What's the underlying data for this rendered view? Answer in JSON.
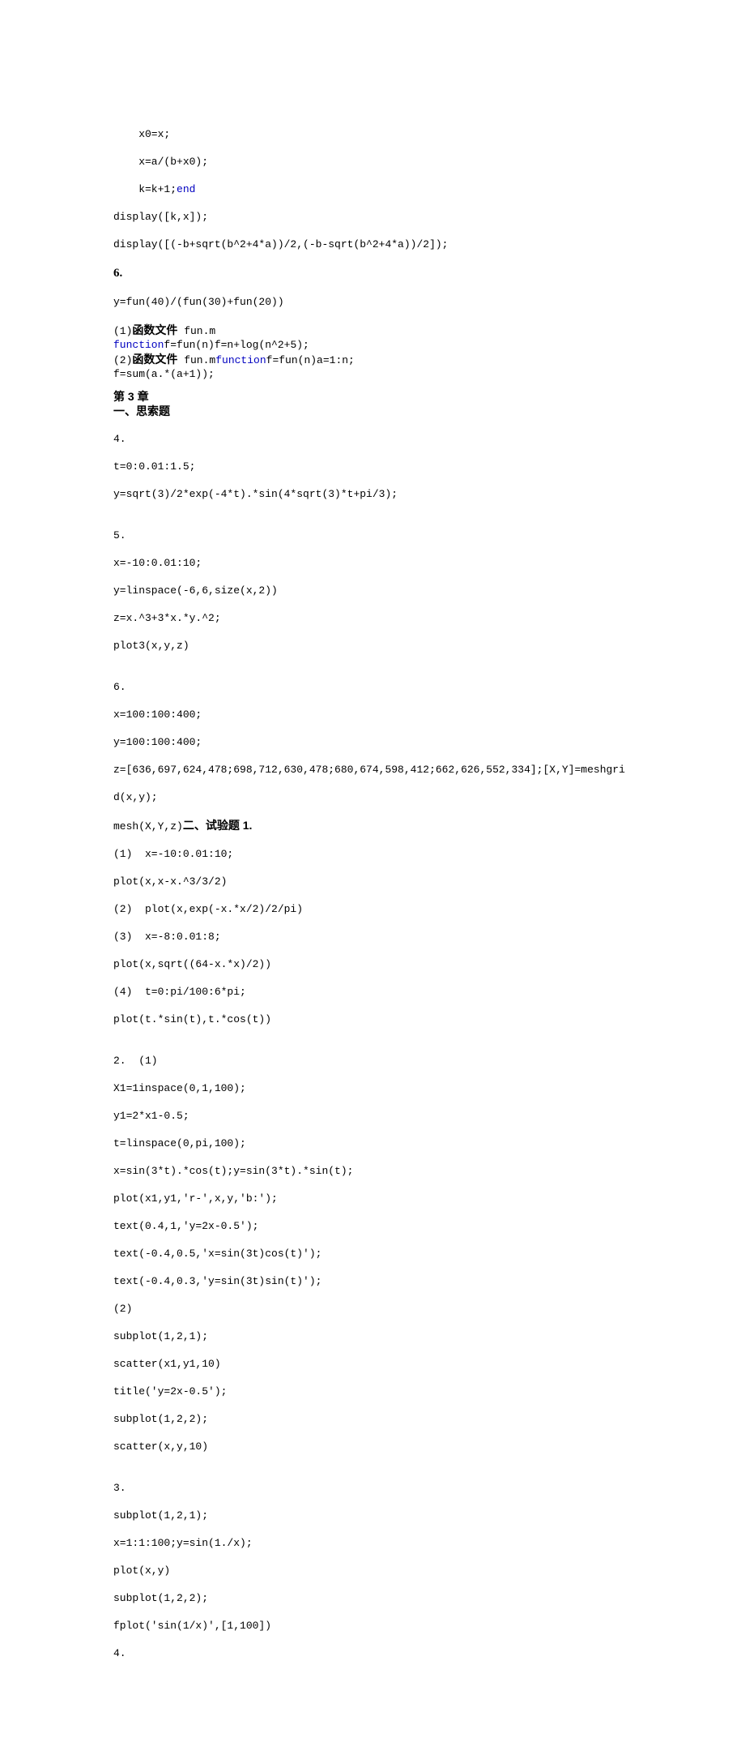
{
  "block1": {
    "l1": "    x0=x;",
    "l2": "    x=a/(b+x0);",
    "l3": "    k=k+1;",
    "l3end": "end",
    "l4": "display([k,x]);",
    "l5": "display([(-b+sqrt(b^2+4*a))/2,(-b-sqrt(b^2+4*a))/2]);"
  },
  "six": "6.",
  "block2": {
    "l1": "y=fun(40)/(fun(30)+fun(20))",
    "l2a": "(1)",
    "l2b": "函数文件",
    "l2c": " fun.m",
    "l3a": "function",
    "l3b": "f=fun(n)f=n+log(n^2+5);",
    "l4a": "(2)",
    "l4b": "函数文件",
    "l4c": " fun.m",
    "l4d": "function",
    "l4e": "f=fun(n)a=1:n;",
    "l5": "f=sum(a.*(a+1));"
  },
  "ch3": {
    "title": "第 3 章",
    "sec1": "一、思索题",
    "q4": "4.",
    "q4l1": "t=0:0.01:1.5;",
    "q4l2": "y=sqrt(3)/2*exp(-4*t).*sin(4*sqrt(3)*t+pi/3);",
    "q5": "5.",
    "q5l1": "x=-10:0.01:10;",
    "q5l2": "y=linspace(-6,6,size(x,2))",
    "q5l3": "z=x.^3+3*x.*y.^2;",
    "q5l4": "plot3(x,y,z)",
    "q6": "6.",
    "q6l1": "x=100:100:400;",
    "q6l2": "y=100:100:400;",
    "q6l3": "z=[636,697,624,478;698,712,630,478;680,674,598,412;662,626,552,334];[X,Y]=meshgri",
    "q6l4": "d(x,y);",
    "q6l5a": "mesh(X,Y,z)",
    "q6l5b": "二、试验题 1.",
    "e1l1": "(1)  x=-10:0.01:10;",
    "e1l2": "plot(x,x-x.^3/3/2)",
    "e1l3": "(2)  plot(x,exp(-x.*x/2)/2/pi)",
    "e1l4": "(3)  x=-8:0.01:8;",
    "e1l5": "plot(x,sqrt((64-x.*x)/2))",
    "e1l6": "(4)  t=0:pi/100:6*pi;",
    "e1l7": "plot(t.*sin(t),t.*cos(t))",
    "e2": "2.  (1)",
    "e2l1": "X1=1inspace(0,1,100);",
    "e2l2": "y1=2*x1-0.5;",
    "e2l3": "t=linspace(0,pi,100);",
    "e2l4": "x=sin(3*t).*cos(t);y=sin(3*t).*sin(t);",
    "e2l5": "plot(x1,y1,'r-',x,y,'b:');",
    "e2l6": "text(0.4,1,'y=2x-0.5');",
    "e2l7": "text(-0.4,0.5,'x=sin(3t)cos(t)');",
    "e2l8": "text(-0.4,0.3,'y=sin(3t)sin(t)');",
    "e2p2": "(2)",
    "e2p2l1": "subplot(1,2,1);",
    "e2p2l2": "scatter(x1,y1,10)",
    "e2p2l3": "title('y=2x-0.5');",
    "e2p2l4": "subplot(1,2,2);",
    "e2p2l5": "scatter(x,y,10)",
    "e3": "3.",
    "e3l1": "subplot(1,2,1);",
    "e3l2": "x=1:1:100;y=sin(1./x);",
    "e3l3": "plot(x,y)",
    "e3l4": "subplot(1,2,2);",
    "e3l5": "fplot('sin(1/x)',[1,100])",
    "e4": "4."
  }
}
